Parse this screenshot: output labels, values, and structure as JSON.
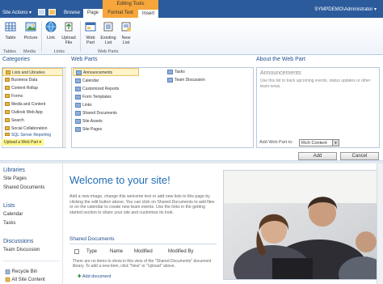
{
  "topbar": {
    "site_actions": "Site Actions ▾",
    "tabs": [
      "Browse",
      "Page"
    ],
    "contextual_group": "Editing Tools",
    "contextual_tabs": [
      "Format Text",
      "Insert"
    ],
    "user": "SYMPDEMO\\Administrator ▾"
  },
  "ribbon": {
    "buttons": [
      {
        "label": "Table",
        "icon": "table-icon"
      },
      {
        "label": "Picture",
        "icon": "picture-icon"
      },
      {
        "label": "Link",
        "icon": "link-icon"
      },
      {
        "label": "Upload File",
        "icon": "upload-file-icon"
      },
      {
        "label": "Web Part",
        "icon": "web-part-icon"
      },
      {
        "label": "Existing List",
        "icon": "existing-list-icon"
      },
      {
        "label": "New List",
        "icon": "new-list-icon"
      }
    ],
    "groups": [
      "Tables",
      "Media",
      "Links",
      "Web Parts"
    ]
  },
  "categories": {
    "heading": "Categories",
    "items": [
      "Lists and Libraries",
      "Business Data",
      "Content Rollup",
      "Forms",
      "Media and Content",
      "Outlook Web App",
      "Search",
      "Social Collaboration",
      "SQL Server Reporting"
    ],
    "selected": "Lists and Libraries",
    "upload": "Upload a Web Part ▾"
  },
  "web_parts": {
    "heading": "Web Parts",
    "col1": [
      "Announcements",
      "Calendar",
      "Customized Reports",
      "Form Templates",
      "Links",
      "Shared Documents",
      "Site Assets",
      "Site Pages"
    ],
    "col2": [
      "Tasks",
      "Team Discussion"
    ],
    "selected": "Announcements"
  },
  "about": {
    "heading": "About the Web Part",
    "title": "Announcements",
    "description": "Use this list to track upcoming events, status updates or other team news.",
    "add_to_label": "Add Web Part to:",
    "add_to_value": "Rich Content",
    "add_button": "Add",
    "cancel_button": "Cancel"
  },
  "quick_launch": {
    "libraries_heading": "Libraries",
    "libraries": [
      "Site Pages",
      "Shared Documents"
    ],
    "lists_heading": "Lists",
    "lists": [
      "Calendar",
      "Tasks"
    ],
    "discussions_heading": "Discussions",
    "discussions": [
      "Team Discussion"
    ],
    "recycle_bin": "Recycle Bin",
    "all_content": "All Site Content"
  },
  "main": {
    "welcome": "Welcome to your site!",
    "welcome_text": "Add a new image, change this welcome text or add new lists to this page by clicking the edit button above. You can click on Shared Documents to add files or on the calendar to create new team events. Use the links in the getting started section to share your site and customize its look.",
    "shared_docs_heading": "Shared Documents",
    "columns": [
      "Type",
      "Name",
      "Modified",
      "Modified By"
    ],
    "empty_text": "There are no items to show in this view of the \"Shared Documents\" document library. To add a new item, click \"New\" or \"Upload\" above.",
    "add_document": "Add document"
  }
}
